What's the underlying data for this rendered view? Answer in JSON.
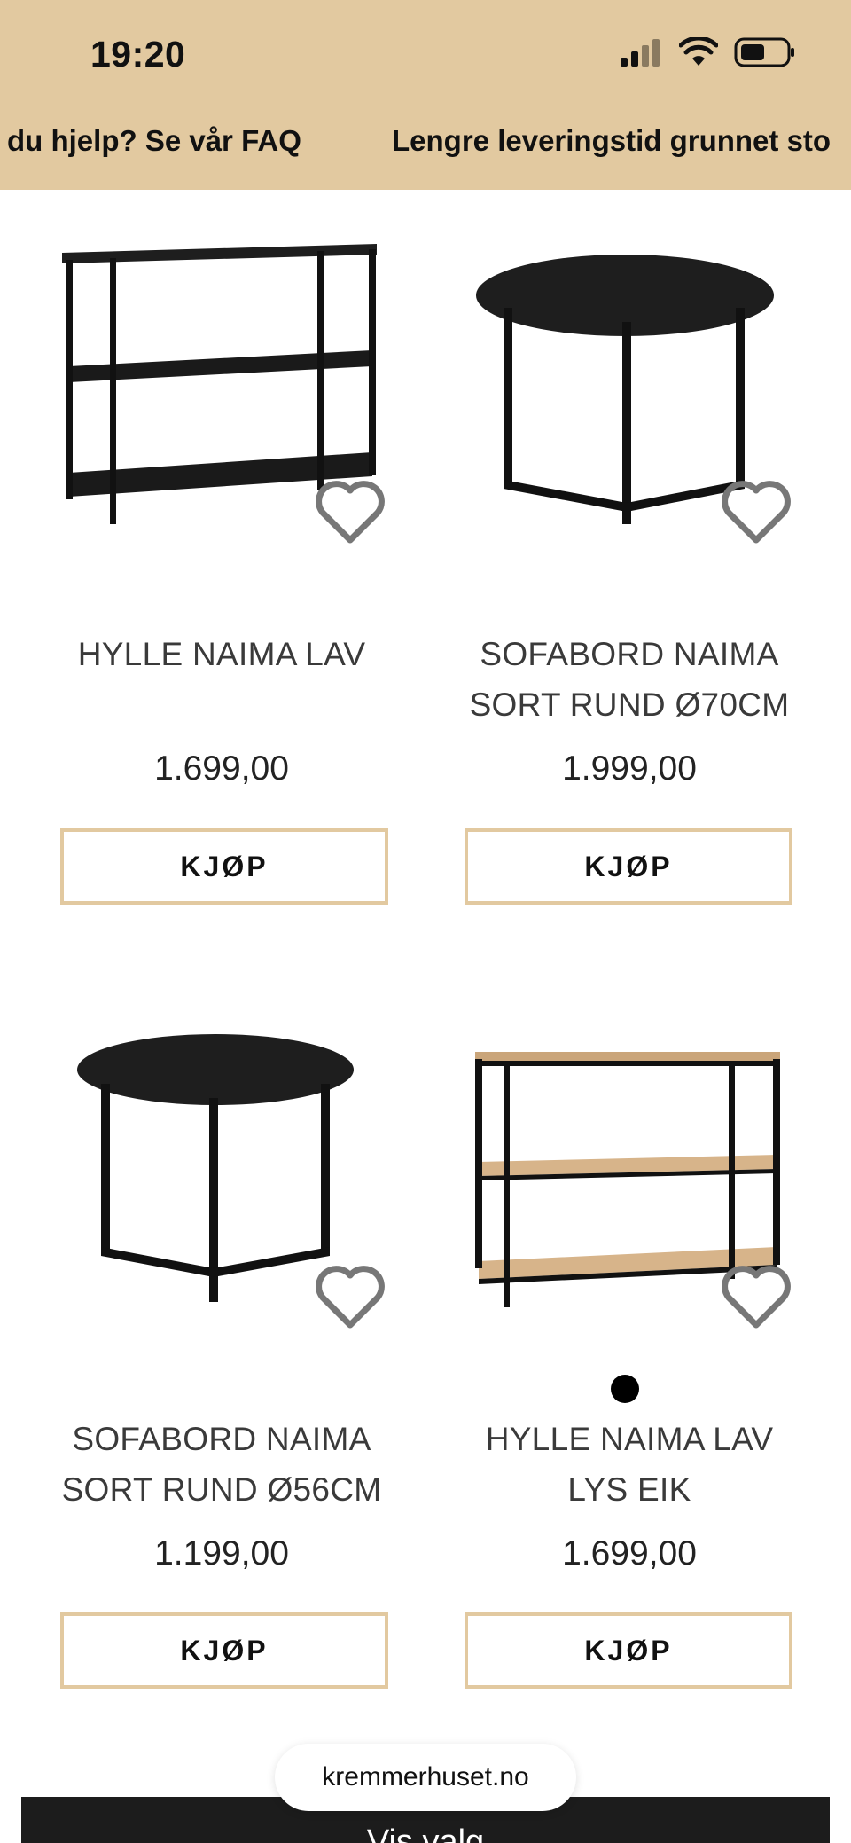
{
  "status_bar": {
    "time": "19:20",
    "icons": [
      "signal-icon",
      "wifi-icon",
      "battery-icon"
    ]
  },
  "announcement": {
    "items": [
      "du hjelp? Se vår FAQ",
      "Lengre leveringstid grunnet sto"
    ],
    "background": "#e2c9a0"
  },
  "products": [
    {
      "title_line1": "HYLLE NAIMA LAV",
      "title_line2": "",
      "price": "1.699,00",
      "buy_label": "KJØP",
      "image": "black-shelf"
    },
    {
      "title_line1": "SOFABORD NAIMA",
      "title_line2": "SORT RUND Ø70CM",
      "price": "1.999,00",
      "buy_label": "KJØP",
      "image": "black-round-table"
    },
    {
      "title_line1": "SOFABORD NAIMA",
      "title_line2": "SORT RUND Ø56CM",
      "price": "1.199,00",
      "buy_label": "KJØP",
      "image": "black-round-table"
    },
    {
      "title_line1": "HYLLE NAIMA LAV",
      "title_line2": "LYS EIK",
      "price": "1.699,00",
      "buy_label": "KJØP",
      "image": "oak-shelf"
    }
  ],
  "browser": {
    "url": "kremmerhuset.no"
  },
  "bottom_bar": {
    "label": "Vis valg"
  },
  "colors": {
    "accent": "#e2c9a0",
    "dark": "#1c1c1c"
  }
}
